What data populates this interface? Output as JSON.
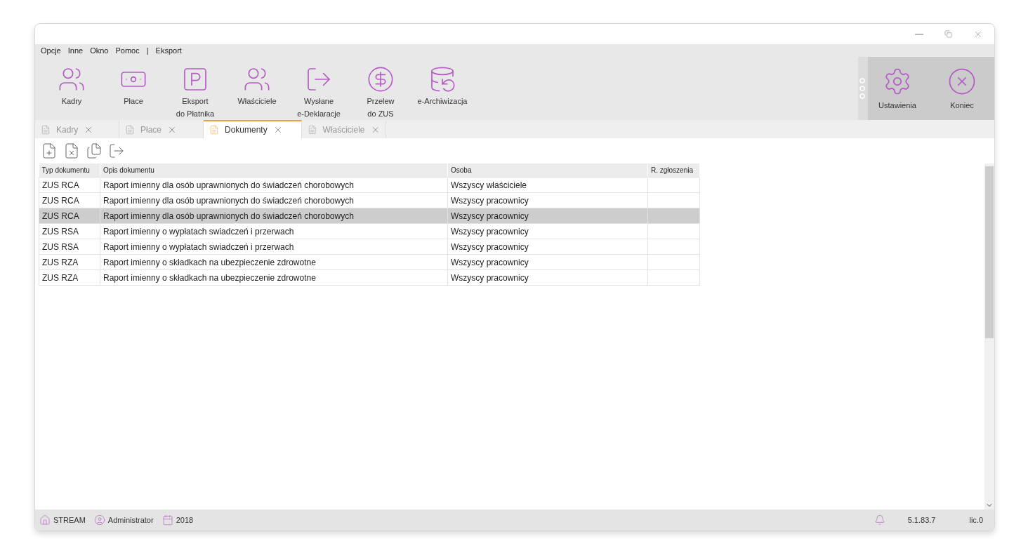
{
  "menu": [
    "Opcje",
    "Inne",
    "Okno",
    "Pomoc",
    "|",
    "Eksport"
  ],
  "ribbon": [
    {
      "lines": [
        "Kadry"
      ]
    },
    {
      "lines": [
        "Płace"
      ]
    },
    {
      "lines": [
        "Eksport",
        "do Płatnika"
      ]
    },
    {
      "lines": [
        "Właściciele"
      ]
    },
    {
      "lines": [
        "Wysłane",
        "e-Deklaracje"
      ]
    },
    {
      "lines": [
        "Przelew",
        "do ZUS"
      ]
    },
    {
      "lines": [
        "e-Archiwizacja"
      ]
    }
  ],
  "ribbon_right": [
    {
      "label": "Ustawienia"
    },
    {
      "label": "Koniec"
    }
  ],
  "tabs": [
    {
      "label": "Kadry",
      "selected": false
    },
    {
      "label": "Płace",
      "selected": false
    },
    {
      "label": "Dokumenty",
      "selected": true
    },
    {
      "label": "Właściciele",
      "selected": false
    }
  ],
  "table": {
    "columns": [
      "Typ dokumentu",
      "Opis dokumentu",
      "Osoba",
      "R. zgłoszenia"
    ],
    "rows": [
      {
        "cells": [
          "ZUS RCA",
          "Raport imienny dla osób uprawnionych do świadczeń chorobowych",
          "Wszyscy właściciele"
        ],
        "selected": false
      },
      {
        "cells": [
          "ZUS RCA",
          "Raport imienny dla osób uprawnionych do świadczeń chorobowych",
          "Wszyscy pracownicy"
        ],
        "selected": false
      },
      {
        "cells": [
          "ZUS RCA",
          "Raport imienny dla osób uprawnionych do świadczeń chorobowych",
          "Wszyscy pracownicy"
        ],
        "selected": true
      },
      {
        "cells": [
          "ZUS RSA",
          "Raport imienny o wypłatach swiadczeń i przerwach",
          "Wszyscy pracownicy"
        ],
        "selected": false
      },
      {
        "cells": [
          "ZUS RSA",
          "Raport imienny o wypłatach swiadczeń i przerwach",
          "Wszyscy pracownicy"
        ],
        "selected": false
      },
      {
        "cells": [
          "ZUS RZA",
          "Raport imienny o składkach na ubezpieczenie zdrowotne",
          "Wszyscy pracownicy"
        ],
        "selected": false
      },
      {
        "cells": [
          "ZUS RZA",
          "Raport imienny o składkach na ubezpieczenie zdrowotne",
          "Wszyscy pracownicy"
        ],
        "selected": false
      }
    ]
  },
  "status_bar": {
    "company": "STREAM",
    "user": "Administrator",
    "year": "2018",
    "version": "5.1.83.7",
    "license": "lic.0"
  }
}
